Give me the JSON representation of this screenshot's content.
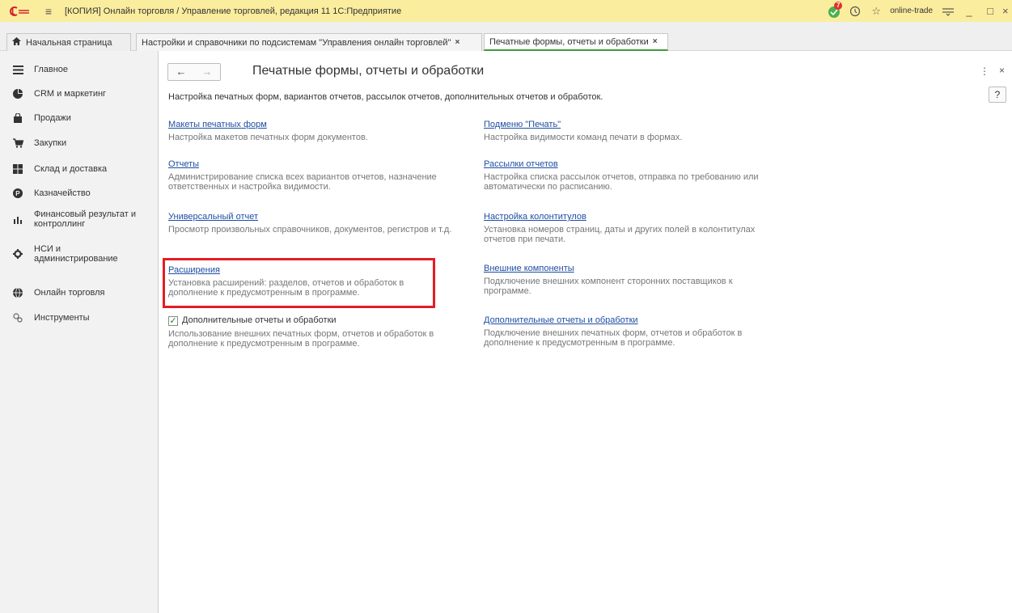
{
  "window": {
    "title": "[КОПИЯ] Онлайн торговля / Управление торговлей, редакция 11 1С:Предприятие",
    "username": "online-trade",
    "notification_count": "7"
  },
  "tabs": [
    {
      "label": "Начальная страница"
    },
    {
      "label": "Настройки и справочники по подсистемам \"Управления онлайн торговлей\""
    },
    {
      "label": "Печатные формы, отчеты и обработки"
    }
  ],
  "sidebar": {
    "items": [
      {
        "label": "Главное",
        "icon": "menu-lines-icon"
      },
      {
        "label": "CRM и маркетинг",
        "icon": "pie-chart-icon"
      },
      {
        "label": "Продажи",
        "icon": "shopping-bag-icon"
      },
      {
        "label": "Закупки",
        "icon": "cart-icon"
      },
      {
        "label": "Склад и доставка",
        "icon": "warehouse-icon"
      },
      {
        "label": "Казначейство",
        "icon": "ruble-coin-icon"
      },
      {
        "label": "Финансовый результат и контроллинг",
        "icon": "bar-chart-icon"
      },
      {
        "label": "НСИ и администрирование",
        "icon": "gear-icon"
      },
      {
        "label": "Онлайн торговля",
        "icon": "globe-icon"
      },
      {
        "label": "Инструменты",
        "icon": "tools-icon"
      }
    ]
  },
  "main": {
    "title": "Печатные формы, отчеты и обработки",
    "description": "Настройка печатных форм, вариантов отчетов, рассылок отчетов, дополнительных отчетов и обработок.",
    "help_label": "?",
    "left": [
      {
        "link": "Макеты печатных форм",
        "desc": "Настройка макетов печатных форм документов."
      },
      {
        "link": "Отчеты",
        "desc": "Администрирование списка всех вариантов отчетов, назначение ответственных и настройка видимости."
      },
      {
        "link": "Универсальный отчет",
        "desc": "Просмотр произвольных справочников, документов, регистров и т.д."
      },
      {
        "link": "Расширения",
        "desc": "Установка расширений: разделов, отчетов и обработок в дополнение к предусмотренным в программе."
      }
    ],
    "checkbox": {
      "label": "Дополнительные отчеты и обработки",
      "checked": true,
      "desc": "Использование внешних печатных форм, отчетов и обработок в дополнение к предусмотренным в программе."
    },
    "right": [
      {
        "link": "Подменю \"Печать\"",
        "desc": "Настройка видимости команд печати в формах."
      },
      {
        "link": "Рассылки отчетов",
        "desc": "Настройка списка рассылок отчетов, отправка по требованию или автоматически по расписанию."
      },
      {
        "link": "Настройка колонтитулов",
        "desc": "Установка номеров страниц, даты и других полей в колонтитулах отчетов при печати."
      },
      {
        "link": "Внешние компоненты",
        "desc": "Подключение внешних компонент сторонних поставщиков к программе."
      },
      {
        "link": "Дополнительные отчеты и обработки",
        "desc": "Подключение внешних печатных форм, отчетов и обработок в дополнение к предусмотренным в программе."
      }
    ]
  },
  "colors": {
    "titlebar": "#fbed9e",
    "link": "#1f4ea3",
    "highlight": "#e31e24",
    "active_tab": "#3d9c3a"
  }
}
